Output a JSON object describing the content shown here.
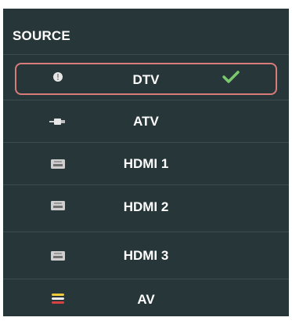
{
  "header": {
    "title": "SOURCE"
  },
  "sources": [
    {
      "label": "DTV",
      "icon": "antenna-icon",
      "selected": true
    },
    {
      "label": "ATV",
      "icon": "rf-connector-icon",
      "selected": false
    },
    {
      "label": "HDMI 1",
      "icon": "hdmi-port-icon",
      "selected": false
    },
    {
      "label": "HDMI 2",
      "icon": "hdmi-port-icon",
      "selected": false
    },
    {
      "label": "HDMI 3",
      "icon": "hdmi-port-icon",
      "selected": false
    },
    {
      "label": "AV",
      "icon": "av-cables-icon",
      "selected": false
    }
  ],
  "colors": {
    "panel_background": "#273638",
    "divider": "#3c4c4f",
    "selection_border": "#d97b7b",
    "checkmark": "#7bc96f"
  }
}
